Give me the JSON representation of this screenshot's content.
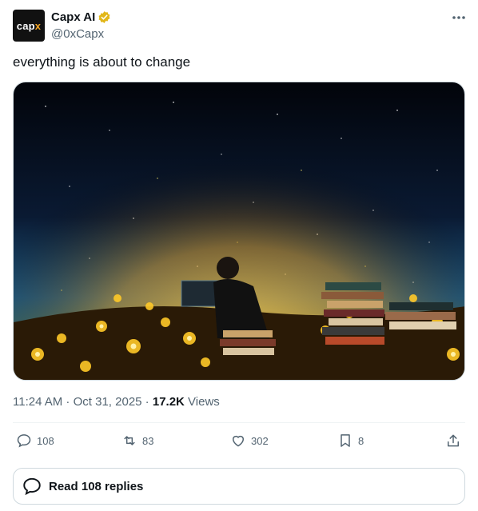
{
  "author": {
    "avatar_text": "cap",
    "avatar_accent_text": "x",
    "display_name": "Capx AI",
    "handle": "@0xCapx",
    "verified_badge_color": "#e2b719"
  },
  "tweet": {
    "text": "everything is about to change",
    "media_icon": "image-night-sky-person-laptop-books-flowers"
  },
  "meta": {
    "time": "11:24 AM",
    "sep1": " · ",
    "date": "Oct 31, 2025",
    "sep2": " · ",
    "views_count": "17.2K",
    "views_label": " Views"
  },
  "actions": {
    "replies": "108",
    "reposts": "83",
    "likes": "302",
    "bookmarks": "8"
  },
  "read_replies": {
    "label": "Read 108 replies"
  },
  "colors": {
    "text": "#0f1419",
    "muted": "#536471",
    "border": "#cfd9de"
  }
}
